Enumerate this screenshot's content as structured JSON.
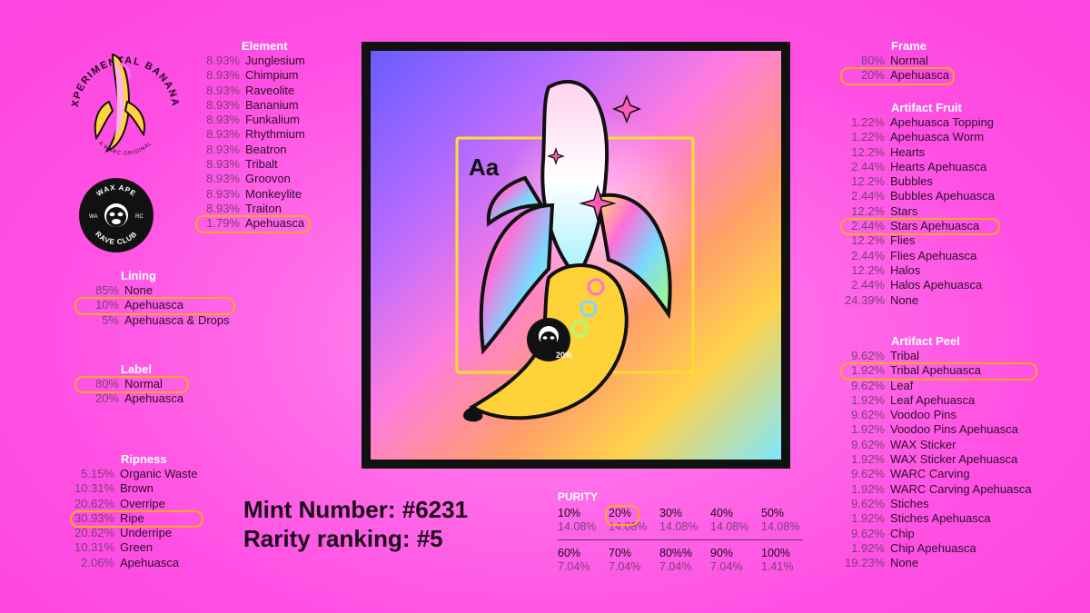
{
  "logo": {
    "top_text": "EXPERIMENTAL BANANAS",
    "sub_text": "A WARC ORIGINAL",
    "badge_top": "WAX APE",
    "badge_bottom": "RAVE CLUB",
    "badge_left": "WA",
    "badge_right": "RC"
  },
  "element": {
    "title": "Element",
    "items": [
      {
        "pct": "8.93%",
        "label": "Junglesium",
        "hl": false
      },
      {
        "pct": "8.93%",
        "label": "Chimpium",
        "hl": false
      },
      {
        "pct": "8.93%",
        "label": "Raveolite",
        "hl": false
      },
      {
        "pct": "8.93%",
        "label": "Bananium",
        "hl": false
      },
      {
        "pct": "8.93%",
        "label": "Funkalium",
        "hl": false
      },
      {
        "pct": "8.93%",
        "label": "Rhythmium",
        "hl": false
      },
      {
        "pct": "8.93%",
        "label": "Beatron",
        "hl": false
      },
      {
        "pct": "8.93%",
        "label": "Tribalt",
        "hl": false
      },
      {
        "pct": "8.93%",
        "label": "Groovon",
        "hl": false
      },
      {
        "pct": "8.93%",
        "label": "Monkeylite",
        "hl": false
      },
      {
        "pct": "8.93%",
        "label": "Traiton",
        "hl": false
      },
      {
        "pct": "1.79%",
        "label": "Apehuasca",
        "hl": true
      }
    ]
  },
  "lining": {
    "title": "Lining",
    "items": [
      {
        "pct": "85%",
        "label": "None",
        "hl": false
      },
      {
        "pct": "10%",
        "label": "Apehuasca",
        "hl": true
      },
      {
        "pct": "5%",
        "label": "Apehuasca & Drops",
        "hl": false
      }
    ]
  },
  "label": {
    "title": "Label",
    "items": [
      {
        "pct": "80%",
        "label": "Normal",
        "hl": true
      },
      {
        "pct": "20%",
        "label": "Apehuasca",
        "hl": false
      }
    ]
  },
  "ripeness": {
    "title": "Ripness",
    "items": [
      {
        "pct": "5.15%",
        "label": "Organic Waste",
        "hl": false
      },
      {
        "pct": "10.31%",
        "label": "Brown",
        "hl": false
      },
      {
        "pct": "20.62%",
        "label": "Overripe",
        "hl": false
      },
      {
        "pct": "30.93%",
        "label": "Ripe",
        "hl": true
      },
      {
        "pct": "20.62%",
        "label": "Underripe",
        "hl": false
      },
      {
        "pct": "10.31%",
        "label": "Green",
        "hl": false
      },
      {
        "pct": "2.06%",
        "label": "Apehuasca",
        "hl": false
      }
    ]
  },
  "frame": {
    "title": "Frame",
    "items": [
      {
        "pct": "80%",
        "label": "Normal",
        "hl": false
      },
      {
        "pct": "20%",
        "label": "Apehuasca",
        "hl": true
      }
    ]
  },
  "artifact_fruit": {
    "title": "Artifact Fruit",
    "items": [
      {
        "pct": "1.22%",
        "label": "Apehuasca Topping",
        "hl": false
      },
      {
        "pct": "1.22%",
        "label": "Apehuasca Worm",
        "hl": false
      },
      {
        "pct": "12.2%",
        "label": "Hearts",
        "hl": false
      },
      {
        "pct": "2.44%",
        "label": "Hearts Apehuasca",
        "hl": false
      },
      {
        "pct": "12.2%",
        "label": "Bubbles",
        "hl": false
      },
      {
        "pct": "2.44%",
        "label": "Bubbles Apehuasca",
        "hl": false
      },
      {
        "pct": "12.2%",
        "label": "Stars",
        "hl": false
      },
      {
        "pct": "2.44%",
        "label": "Stars Apehuasca",
        "hl": true
      },
      {
        "pct": "12.2%",
        "label": "Flies",
        "hl": false
      },
      {
        "pct": "2.44%",
        "label": "Flies Apehuasca",
        "hl": false
      },
      {
        "pct": "12.2%",
        "label": "Halos",
        "hl": false
      },
      {
        "pct": "2.44%",
        "label": "Halos Apehuasca",
        "hl": false
      },
      {
        "pct": "24.39%",
        "label": "None",
        "hl": false
      }
    ]
  },
  "artifact_peel": {
    "title": "Artifact Peel",
    "items": [
      {
        "pct": "9.62%",
        "label": "Tribal",
        "hl": false
      },
      {
        "pct": "1.92%",
        "label": "Tribal Apehuasca",
        "hl": true
      },
      {
        "pct": "9.62%",
        "label": "Leaf",
        "hl": false
      },
      {
        "pct": "1.92%",
        "label": "Leaf Apehuasca",
        "hl": false
      },
      {
        "pct": "9.62%",
        "label": "Voodoo Pins",
        "hl": false
      },
      {
        "pct": "1.92%",
        "label": "Voodoo Pins Apehuasca",
        "hl": false
      },
      {
        "pct": "9.62%",
        "label": "WAX Sticker",
        "hl": false
      },
      {
        "pct": "1.92%",
        "label": "WAX Sticker Apehuasca",
        "hl": false
      },
      {
        "pct": "9.62%",
        "label": "WARC Carving",
        "hl": false
      },
      {
        "pct": "1.92%",
        "label": "WARC Carving Apehuasca",
        "hl": false
      },
      {
        "pct": "9.62%",
        "label": "Stiches",
        "hl": false
      },
      {
        "pct": "1.92%",
        "label": "Stiches Apehuasca",
        "hl": false
      },
      {
        "pct": "9.62%",
        "label": "Chip",
        "hl": false
      },
      {
        "pct": "1.92%",
        "label": "Chip Apehuasca",
        "hl": false
      },
      {
        "pct": "19.23%",
        "label": "None",
        "hl": false
      }
    ]
  },
  "mint": {
    "number_text": "Mint Number: #6231",
    "rank_text": "Rarity ranking: #5"
  },
  "purity": {
    "title": "PURITY",
    "row1": [
      {
        "key": "10%",
        "val": "14.08%",
        "hl": false
      },
      {
        "key": "20%",
        "val": "14.08%",
        "hl": true
      },
      {
        "key": "30%",
        "val": "14.08%",
        "hl": false
      },
      {
        "key": "40%",
        "val": "14.08%",
        "hl": false
      },
      {
        "key": "50%",
        "val": "14.08%",
        "hl": false
      }
    ],
    "row2": [
      {
        "key": "60%",
        "val": "7.04%",
        "hl": false
      },
      {
        "key": "70%",
        "val": "7.04%",
        "hl": false
      },
      {
        "key": "80%%",
        "val": "7.04%",
        "hl": false
      },
      {
        "key": "90%",
        "val": "7.04%",
        "hl": false
      },
      {
        "key": "100%",
        "val": "1.41%",
        "hl": false
      }
    ]
  },
  "artwork": {
    "element_symbol": "Aa",
    "label_sticker": "20%"
  },
  "colors": {
    "background": "#ff4fe3",
    "highlight": "#ffa824",
    "title_text": "#ffffff",
    "frame": "#111111"
  }
}
